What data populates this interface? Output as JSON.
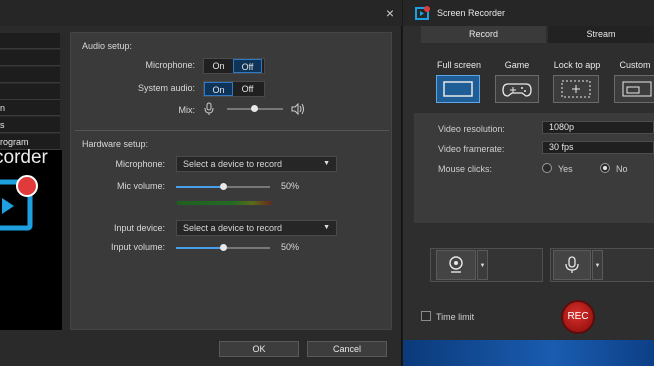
{
  "dialog": {
    "close_icon": "×",
    "nav": [
      "n",
      "s",
      "rogram"
    ],
    "logo_text": "corder",
    "audio": {
      "section_title": "Audio setup:",
      "microphone_label": "Microphone:",
      "system_audio_label": "System audio:",
      "mix_label": "Mix:",
      "on": "On",
      "off": "Off",
      "microphone_value": "Off",
      "system_audio_value": "On",
      "mix_level": 0.5
    },
    "hardware": {
      "section_title": "Hardware setup:",
      "microphone_label": "Microphone:",
      "microphone_placeholder": "Select a device to record",
      "mic_volume_label": "Mic volume:",
      "mic_volume_value": "50%",
      "input_device_label": "Input device:",
      "input_device_placeholder": "Select a device to record",
      "input_volume_label": "Input volume:",
      "input_volume_value": "50%"
    },
    "ok_label": "OK",
    "cancel_label": "Cancel"
  },
  "recorder": {
    "title": "Screen Recorder",
    "tabs": [
      "Record",
      "Stream"
    ],
    "active_tab": "Record",
    "modes": [
      "Full screen",
      "Game",
      "Lock to app",
      "Custom"
    ],
    "selected_mode": "Full screen",
    "video_resolution_label": "Video resolution:",
    "video_resolution_value": "1080p",
    "video_framerate_label": "Video framerate:",
    "video_framerate_value": "30 fps",
    "mouse_clicks_label": "Mouse clicks:",
    "yes_label": "Yes",
    "no_label": "No",
    "mouse_clicks_value": "No",
    "time_limit_label": "Time limit",
    "rec_label": "REC"
  },
  "colors": {
    "accent": "#2f7ac8",
    "rec_red": "#c0201d",
    "logo_blue": "#1ea0e0"
  }
}
